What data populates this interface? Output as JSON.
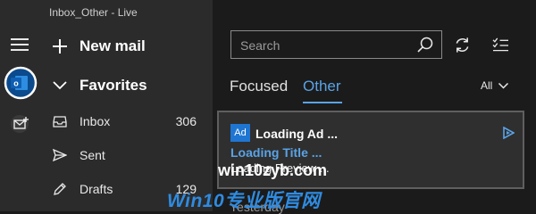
{
  "window": {
    "title": "Inbox_Other - Live"
  },
  "rail": {
    "menu_icon": "hamburger-icon",
    "account_icon": "outlook-icon",
    "compose_icon": "new-mail-icon"
  },
  "nav": {
    "new_mail": "New mail",
    "favorites": "Favorites",
    "folders": [
      {
        "label": "Inbox",
        "count": "306",
        "icon": "inbox-icon"
      },
      {
        "label": "Sent",
        "count": "",
        "icon": "send-icon"
      },
      {
        "label": "Drafts",
        "count": "129",
        "icon": "pencil-icon"
      }
    ]
  },
  "search": {
    "placeholder": "Search"
  },
  "tabs": {
    "focused": "Focused",
    "other": "Other"
  },
  "filter": {
    "label": "All"
  },
  "ad": {
    "badge": "Ad",
    "title": "Loading Ad ...",
    "subtitle": "Loading Title ...",
    "preview": "Loading Preview ..."
  },
  "list": {
    "group_header": "Yesterday"
  },
  "watermark": {
    "site": "win10zyb.com",
    "brand": "Win10专业版官网"
  },
  "colors": {
    "accent": "#5aa3e6",
    "ad_badge": "#1f76d2",
    "pane_bg": "#2b2b2b",
    "list_bg": "#1b1b1b"
  }
}
